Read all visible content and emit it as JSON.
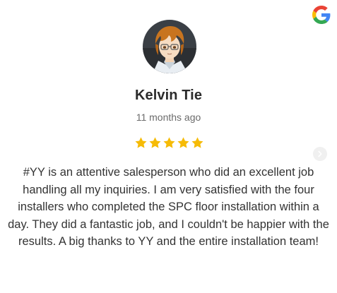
{
  "review": {
    "reviewer_name": "Kelvin Tie",
    "time_ago": "11 months ago",
    "rating": 5,
    "rating_max": 5,
    "text": "#YY is an attentive salesperson who did an excellent job handling all my inquiries. I am very satisfied with the four installers who completed the SPC floor installation within a day. They did a fantastic job, and I couldn't be happier with the results. A big thanks to YY and the entire installation team!"
  },
  "icons": {
    "source_logo": "google-logo-icon",
    "star": "star-icon",
    "next": "chevron-right-icon"
  },
  "colors": {
    "star": "#f6bb06",
    "name": "#2b2b2b",
    "time": "#6b6b6b",
    "text": "#333333"
  }
}
